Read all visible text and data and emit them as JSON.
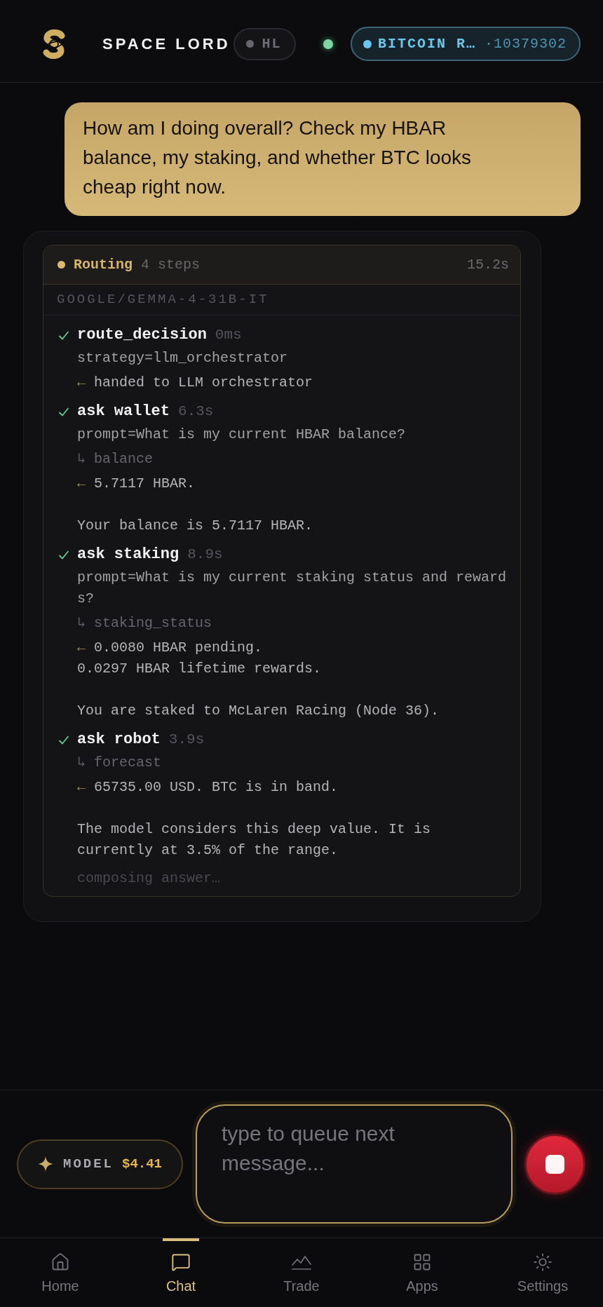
{
  "header": {
    "brand": "SPACE LORD",
    "network_pill": {
      "label": "HL",
      "active": false
    },
    "connected": true,
    "chain_pill": {
      "label": "BITCOIN R…",
      "block": "·10379302"
    }
  },
  "user_message": "How am I doing overall? Check my HBAR balance, my staking, and whether BTC looks cheap right now.",
  "routing": {
    "running": true,
    "title": "Routing",
    "step_count": "4 steps",
    "elapsed": "15.2s",
    "model": "GOOGLE/GEMMA-4-31B-IT",
    "steps": [
      {
        "name": "route_decision",
        "duration": "0ms",
        "done": true,
        "lines": [
          {
            "kind": "param",
            "text": "strategy=llm_orchestrator"
          },
          {
            "kind": "result",
            "marker": "←",
            "text": "handed to LLM orchestrator"
          }
        ]
      },
      {
        "name": "ask wallet",
        "duration": "6.3s",
        "done": true,
        "lines": [
          {
            "kind": "param",
            "text": "prompt=What is my current HBAR balance?"
          },
          {
            "kind": "tool",
            "marker": "↳",
            "text": "balance"
          },
          {
            "kind": "result",
            "marker": "←",
            "text": "5.7117 HBAR.\n\nYour balance is 5.7117 HBAR."
          }
        ]
      },
      {
        "name": "ask staking",
        "duration": "8.9s",
        "done": true,
        "lines": [
          {
            "kind": "param",
            "text": "prompt=What is my current staking status and rewards?"
          },
          {
            "kind": "tool",
            "marker": "↳",
            "text": "staking_status"
          },
          {
            "kind": "result",
            "marker": "←",
            "text": "0.0080 HBAR pending.\n0.0297 HBAR lifetime rewards.\n\nYou are staked to McLaren Racing (Node 36)."
          }
        ]
      },
      {
        "name": "ask robot",
        "duration": "3.9s",
        "done": true,
        "lines": [
          {
            "kind": "tool",
            "marker": "↳",
            "text": "forecast"
          },
          {
            "kind": "result",
            "marker": "←",
            "text": "65735.00 USD. BTC is in band.\n\nThe model considers this deep value. It is currently at 3.5% of the range."
          }
        ]
      }
    ],
    "status_text": "composing answer…"
  },
  "composer": {
    "model_button": {
      "label": "MODEL",
      "cost": "$4.41"
    },
    "input": {
      "placeholder": "type to queue next message..."
    },
    "busy": true
  },
  "nav": [
    {
      "kind": "home",
      "label": "Home",
      "selected": false
    },
    {
      "kind": "chat",
      "label": "Chat",
      "selected": true
    },
    {
      "kind": "trade",
      "label": "Trade",
      "selected": false
    },
    {
      "kind": "apps",
      "label": "Apps",
      "selected": false
    },
    {
      "kind": "settings",
      "label": "Settings",
      "selected": false
    }
  ]
}
